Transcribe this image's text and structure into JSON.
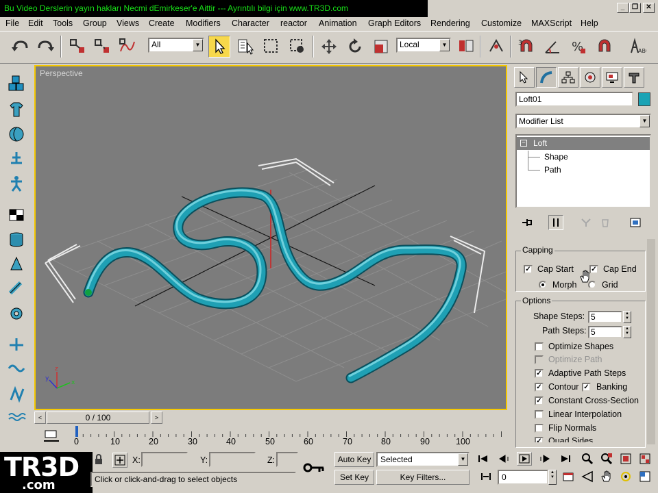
{
  "title": {
    "text": "Bu Video Derslerin yayın hakları Necmi dEmirkeser'e Aittir --- Ayrıntılı bilgi için www.TR3D.com",
    "minimize": "_",
    "restore": "❐",
    "close": "✕"
  },
  "menu": {
    "items": [
      "File",
      "Edit",
      "Tools",
      "Group",
      "Views",
      "Create",
      "Modifiers",
      "Character",
      "reactor",
      "Animation",
      "Graph Editors",
      "Rendering",
      "Customize",
      "MAXScript",
      "Help"
    ]
  },
  "toolbar": {
    "selection_filter": "All",
    "reference_coord": "Local"
  },
  "viewport": {
    "label": "Perspective",
    "colors": {
      "tube": "#1fa0b4",
      "grid": "#8a8a8a",
      "axis": "#000000",
      "border": "#f5c800"
    }
  },
  "command_panel": {
    "object_name": "Loft01",
    "object_color": "#1aa3b5",
    "modifier_list": "Modifier List",
    "stack": {
      "base": "Loft",
      "shape": "Shape",
      "path": "Path"
    },
    "capping": {
      "title": "Capping",
      "cap_start": "Cap Start",
      "cap_start_checked": true,
      "cap_end": "Cap End",
      "cap_end_checked": true,
      "morph": "Morph",
      "grid": "Grid",
      "selected": "Morph"
    },
    "options": {
      "title": "Options",
      "shape_steps_label": "Shape Steps:",
      "shape_steps": "5",
      "path_steps_label": "Path Steps:",
      "path_steps": "5",
      "checks": [
        {
          "label": "Optimize Shapes",
          "checked": false,
          "disabled": false
        },
        {
          "label": "Optimize Path",
          "checked": false,
          "disabled": true
        },
        {
          "label": "Adaptive Path Steps",
          "checked": true,
          "disabled": false
        },
        {
          "label": "Contour",
          "checked": true,
          "disabled": false
        },
        {
          "label": "Constant Cross-Section",
          "checked": true,
          "disabled": false
        },
        {
          "label": "Linear Interpolation",
          "checked": false,
          "disabled": false
        },
        {
          "label": "Flip Normals",
          "checked": false,
          "disabled": false
        },
        {
          "label": "Quad Sides",
          "checked": true,
          "disabled": false
        }
      ],
      "banking": "Banking",
      "banking_checked": true
    }
  },
  "timeline": {
    "frame_display": "0 / 100",
    "prev": "<",
    "next": ">",
    "ticks": [
      "0",
      "10",
      "20",
      "30",
      "40",
      "50",
      "60",
      "70",
      "80",
      "90",
      "100"
    ]
  },
  "status": {
    "x_label": "X:",
    "y_label": "Y:",
    "z_label": "Z:",
    "prompt": "Click or click-and-drag to select objects",
    "auto_key": "Auto Key",
    "set_key": "Set Key",
    "key_mode": "Selected",
    "key_filters": "Key Filters...",
    "current_frame": "0"
  },
  "logo": {
    "main": "TR3D",
    "sub": ".com"
  }
}
